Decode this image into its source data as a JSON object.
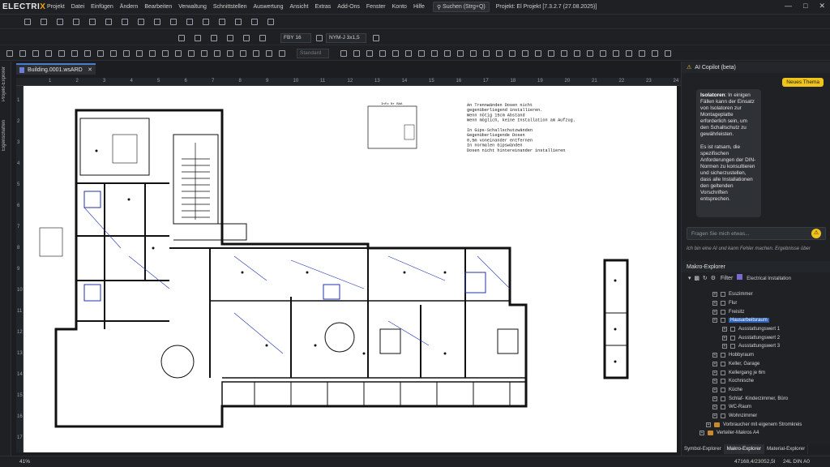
{
  "app": {
    "logo_text": "ELECTRI",
    "logo_x": "X",
    "project": "Projekt: El Projekt [7.3.2.7 (27.08.2025)]"
  },
  "menu": [
    "Projekt",
    "Datei",
    "Einfügen",
    "Ändern",
    "Bearbeiten",
    "Verwaltung",
    "Schnittstellen",
    "Auswertung",
    "Ansicht",
    "Extras",
    "Add-Ons",
    "Fenster",
    "Konto",
    "Hilfe"
  ],
  "search": {
    "label": "Suchen (Strg+Q)"
  },
  "toolbar": {
    "cable1": "FBY 16",
    "cable2": "NYM-J 3x1,5",
    "style": "Standard"
  },
  "left_tabs": [
    "Projekt-Explorer",
    "Eigenschaften"
  ],
  "document": {
    "tab": "Building.0001.wsARD"
  },
  "ruler": {
    "h": [
      "1",
      "2",
      "3",
      "4",
      "5",
      "6",
      "7",
      "8",
      "9",
      "10",
      "11",
      "12",
      "13",
      "14",
      "15",
      "16",
      "17",
      "18",
      "19",
      "20",
      "21",
      "22",
      "23",
      "24"
    ],
    "v": [
      "1",
      "2",
      "3",
      "4",
      "5",
      "6",
      "7",
      "8",
      "9",
      "10",
      "11",
      "12",
      "13",
      "14",
      "15",
      "16",
      "17"
    ]
  },
  "drawing": {
    "notes": [
      "An Trennwänden Dosen nicht",
      "gegenüberliegend installieren.",
      "Wenn nötig 15cm Abstand",
      "Wenn möglich, keine Installation am Aufzug.",
      "",
      "In Gips-Schallschutzwänden",
      "Gegenüberliegende Dosen",
      "0,5m voneinander entfernen",
      "In normalen Gipswänden",
      "Dosen nicht hintereinander installieren"
    ],
    "info_title": "Info Nr BAA"
  },
  "copilot": {
    "title": "AI Copilot (beta)",
    "new_topic": "Neues Thema",
    "message_bold": "Isolatoren",
    "message": ": In einigen Fällen kann der Einsatz von Isolatoren zur Montageplatte erforderlich sein, um den Schallschutz zu gewährleisten.",
    "message2": "Es ist ratsam, die spezifischen Anforderungen der DIN-Normen zu konsultieren und sicherzustellen, dass alle Installationen den geltenden Vorschriften entsprechen.",
    "placeholder": "Fragen Sie mich etwas...",
    "disclaimer": "Ich bin eine AI und kann Fehler machen. Ergebnisse über"
  },
  "makro": {
    "title": "Makro-Explorer",
    "filter_label": "Filter",
    "filter_value": "Electrical Installation",
    "items": [
      "Esszimmer",
      "Flur",
      "Freisitz",
      "Hausarbeitsraum",
      "Ausstattungswert 1",
      "Ausstattungswert 2",
      "Ausstattungswert 3",
      "Hobbyraum",
      "Keller, Garage",
      "Kellergang je 6m",
      "Kochnische",
      "Küche",
      "Schlaf- Kinderzimmer, Büro",
      "WC-Raum",
      "Wohnzimmer",
      "Vorbraucher mit eigenem Stromkreis",
      "Verteiler-Makros A4"
    ],
    "tabs": [
      "Symbol-Explorer",
      "Makro-Explorer",
      "Material-Explorer"
    ]
  },
  "status": {
    "zoom": "41%",
    "coords": "47168,4/23052,5I",
    "scale": "24L DIN A0"
  }
}
